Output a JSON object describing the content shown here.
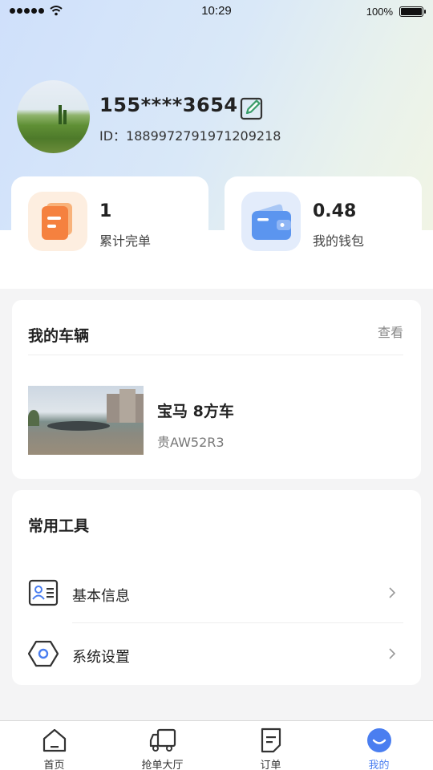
{
  "status_bar": {
    "time": "10:29",
    "battery": "100%"
  },
  "profile": {
    "phone": "155****3654",
    "id_text": "ID：1889972791971209218"
  },
  "stats": [
    {
      "value": "1",
      "label": "累计完单"
    },
    {
      "value": "0.48",
      "label": "我的钱包"
    }
  ],
  "vehicle": {
    "title": "我的车辆",
    "view_label": "查看",
    "name": "宝马 8方车",
    "plate": "贵AW52R3"
  },
  "tools": {
    "title": "常用工具",
    "items": [
      {
        "label": "基本信息",
        "icon": "id-card-icon"
      },
      {
        "label": "系统设置",
        "icon": "settings-hex-icon"
      }
    ]
  },
  "tabbar": {
    "items": [
      {
        "label": "首页",
        "icon": "home-icon"
      },
      {
        "label": "抢单大厅",
        "icon": "truck-icon"
      },
      {
        "label": "订单",
        "icon": "order-icon"
      },
      {
        "label": "我的",
        "icon": "smile-icon"
      }
    ],
    "active_index": 3
  },
  "colors": {
    "accent": "#4a7ef0",
    "orange": "#f5813f",
    "blue": "#5b95ef"
  }
}
